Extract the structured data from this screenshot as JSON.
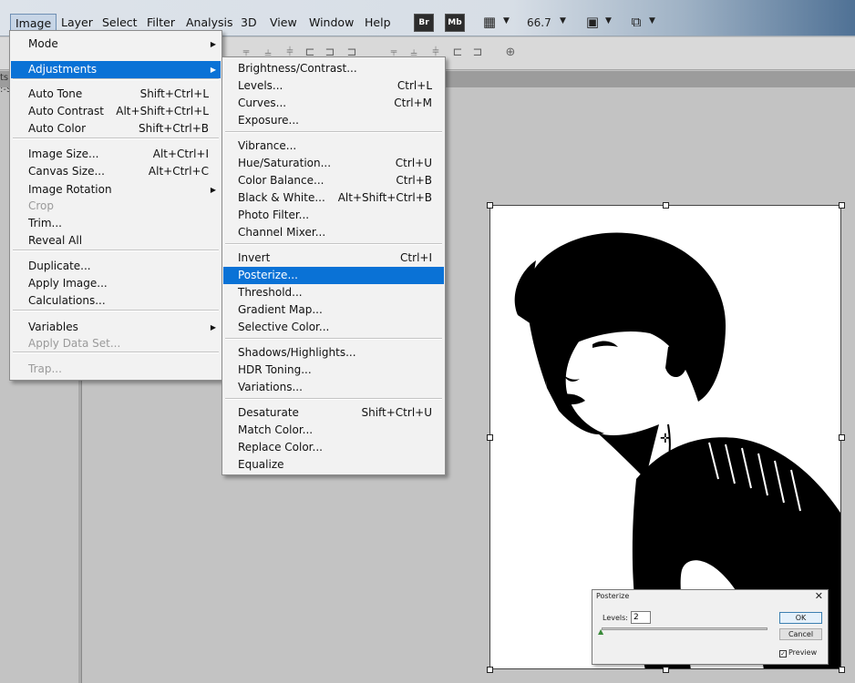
{
  "menubar": {
    "items": [
      "Image",
      "Layer",
      "Select",
      "Filter",
      "Analysis",
      "3D",
      "View",
      "Window",
      "Help"
    ],
    "br_label": "Br",
    "mb_label": "Mb",
    "zoom": "66.7"
  },
  "image_menu": {
    "items": [
      {
        "label": "Mode",
        "shortcut": "",
        "submenu": true,
        "disabled": false
      },
      {
        "label": "Adjustments",
        "shortcut": "",
        "submenu": true,
        "disabled": false
      },
      {
        "label": "Auto Tone",
        "shortcut": "Shift+Ctrl+L",
        "submenu": false,
        "disabled": false
      },
      {
        "label": "Auto Contrast",
        "shortcut": "Alt+Shift+Ctrl+L",
        "submenu": false,
        "disabled": false
      },
      {
        "label": "Auto Color",
        "shortcut": "Shift+Ctrl+B",
        "submenu": false,
        "disabled": false
      },
      {
        "label": "Image Size...",
        "shortcut": "Alt+Ctrl+I",
        "submenu": false,
        "disabled": false
      },
      {
        "label": "Canvas Size...",
        "shortcut": "Alt+Ctrl+C",
        "submenu": false,
        "disabled": false
      },
      {
        "label": "Image Rotation",
        "shortcut": "",
        "submenu": true,
        "disabled": false
      },
      {
        "label": "Crop",
        "shortcut": "",
        "submenu": false,
        "disabled": true
      },
      {
        "label": "Trim...",
        "shortcut": "",
        "submenu": false,
        "disabled": false
      },
      {
        "label": "Reveal All",
        "shortcut": "",
        "submenu": false,
        "disabled": false
      },
      {
        "label": "Duplicate...",
        "shortcut": "",
        "submenu": false,
        "disabled": false
      },
      {
        "label": "Apply Image...",
        "shortcut": "",
        "submenu": false,
        "disabled": false
      },
      {
        "label": "Calculations...",
        "shortcut": "",
        "submenu": false,
        "disabled": false
      },
      {
        "label": "Variables",
        "shortcut": "",
        "submenu": true,
        "disabled": false
      },
      {
        "label": "Apply Data Set...",
        "shortcut": "",
        "submenu": false,
        "disabled": true
      },
      {
        "label": "Trap...",
        "shortcut": "",
        "submenu": false,
        "disabled": true
      }
    ]
  },
  "adjustments_menu": {
    "items": [
      {
        "label": "Brightness/Contrast...",
        "shortcut": ""
      },
      {
        "label": "Levels...",
        "shortcut": "Ctrl+L"
      },
      {
        "label": "Curves...",
        "shortcut": "Ctrl+M"
      },
      {
        "label": "Exposure...",
        "shortcut": ""
      },
      {
        "label": "Vibrance...",
        "shortcut": ""
      },
      {
        "label": "Hue/Saturation...",
        "shortcut": "Ctrl+U"
      },
      {
        "label": "Color Balance...",
        "shortcut": "Ctrl+B"
      },
      {
        "label": "Black & White...",
        "shortcut": "Alt+Shift+Ctrl+B"
      },
      {
        "label": "Photo Filter...",
        "shortcut": ""
      },
      {
        "label": "Channel Mixer...",
        "shortcut": ""
      },
      {
        "label": "Invert",
        "shortcut": "Ctrl+I"
      },
      {
        "label": "Posterize...",
        "shortcut": ""
      },
      {
        "label": "Threshold...",
        "shortcut": ""
      },
      {
        "label": "Gradient Map...",
        "shortcut": ""
      },
      {
        "label": "Selective Color...",
        "shortcut": ""
      },
      {
        "label": "Shadows/Highlights...",
        "shortcut": ""
      },
      {
        "label": "HDR Toning...",
        "shortcut": ""
      },
      {
        "label": "Variations...",
        "shortcut": ""
      },
      {
        "label": "Desaturate",
        "shortcut": "Shift+Ctrl+U"
      },
      {
        "label": "Match Color...",
        "shortcut": ""
      },
      {
        "label": "Replace Color...",
        "shortcut": ""
      },
      {
        "label": "Equalize",
        "shortcut": ""
      }
    ]
  },
  "posterize_dialog": {
    "title": "Posterize",
    "levels_label": "Levels:",
    "levels_value": "2",
    "ok_label": "OK",
    "cancel_label": "Cancel",
    "preview_label": "Preview",
    "preview_checked": true
  },
  "colors": {
    "highlight": "#0a72d6",
    "menu_bg": "#f2f2f2",
    "workspace": "#c3c3c3"
  }
}
